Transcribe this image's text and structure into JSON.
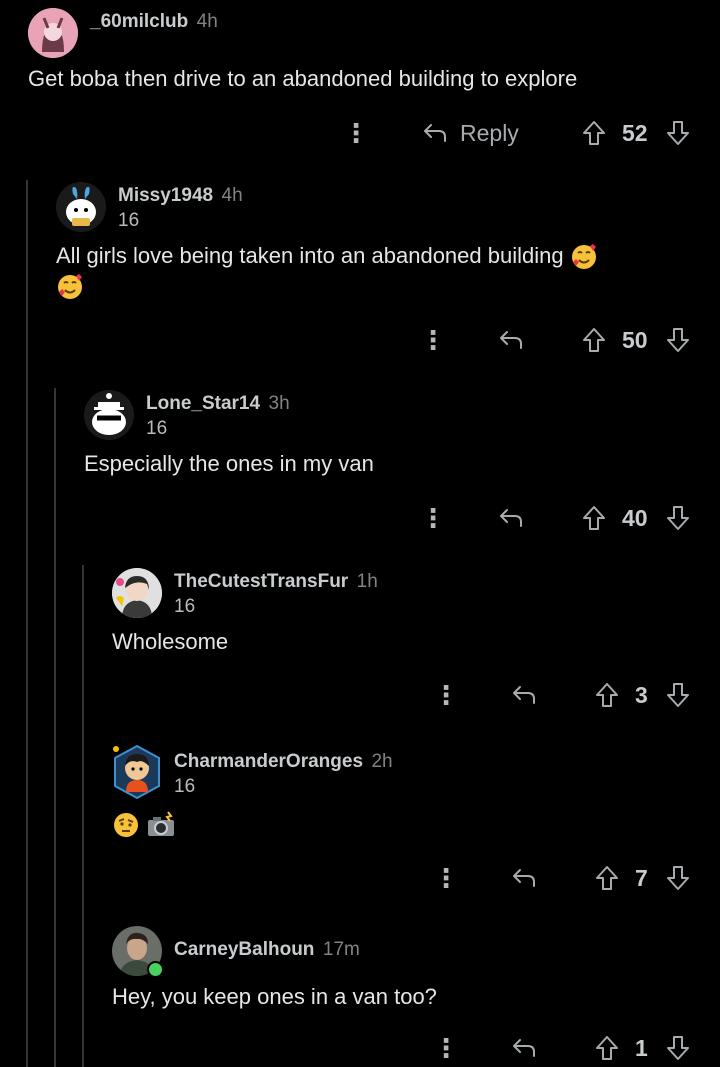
{
  "comments": [
    {
      "user": "_60milclub",
      "time": "4h",
      "flair": "",
      "body": "Get boba then drive to an abandoned building to explore",
      "score": "52",
      "reply_label": "Reply"
    },
    {
      "user": "Missy1948",
      "time": "4h",
      "flair": "16",
      "body": "All girls love being taken into an abandoned building",
      "score": "50"
    },
    {
      "user": "Lone_Star14",
      "time": "3h",
      "flair": "16",
      "body": "Especially the ones in my van",
      "score": "40"
    },
    {
      "user": "TheCutestTransFur",
      "time": "1h",
      "flair": "16",
      "body": "Wholesome",
      "score": "3"
    },
    {
      "user": "CharmanderOranges",
      "time": "2h",
      "flair": "16",
      "body": "",
      "score": "7"
    },
    {
      "user": "CarneyBalhoun",
      "time": "17m",
      "flair": "",
      "body": "Hey, you keep ones in a van too?",
      "score": "1"
    }
  ],
  "icons": {
    "more": "more-options-icon",
    "reply": "reply-arrow-icon",
    "upvote": "upvote-arrow-icon",
    "downvote": "downvote-arrow-icon",
    "smiling_hearts": "smiling-face-with-hearts-emoji",
    "raised_eyebrow": "raised-eyebrow-emoji",
    "camera_flash": "camera-with-flash-emoji"
  },
  "colors": {
    "background": "#000000",
    "thread_line": "#343536",
    "online": "#46d160"
  }
}
